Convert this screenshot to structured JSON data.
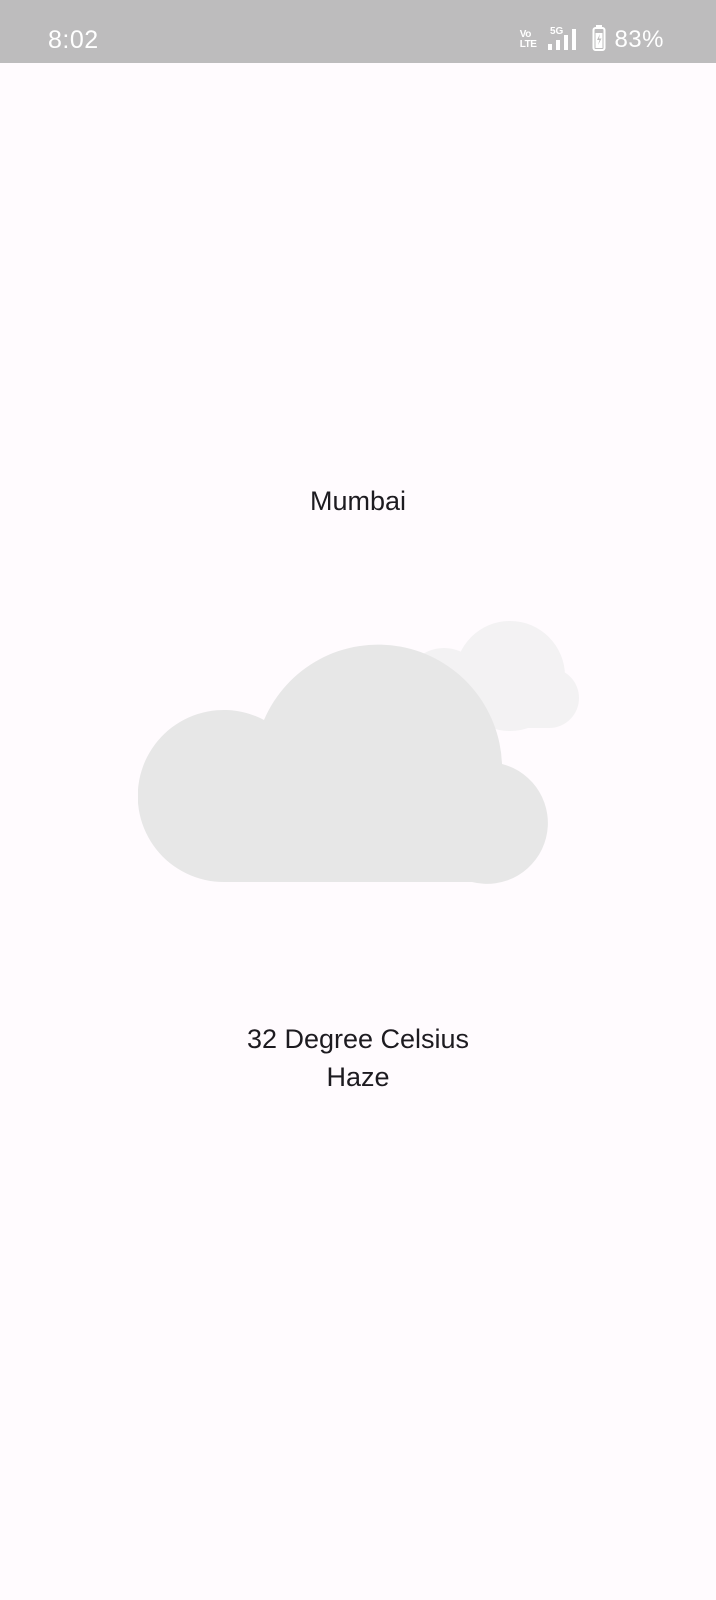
{
  "status_bar": {
    "time": "8:02",
    "volte_top": "Vo",
    "volte_bottom": "LTE",
    "network": "5G",
    "battery": "83%",
    "icons": [
      "volte-icon",
      "signal-5g-icon",
      "battery-charging-icon"
    ]
  },
  "weather": {
    "city": "Mumbai",
    "icon": "cloudy-icon",
    "temperature": "32 Degree Celsius",
    "condition": "Haze"
  },
  "colors": {
    "background": "#fffbfe",
    "status_bar": "#bdbcbd",
    "text": "#1d1b20",
    "cloud_front": "#e7e7e7",
    "cloud_back": "#f3f2f3"
  }
}
